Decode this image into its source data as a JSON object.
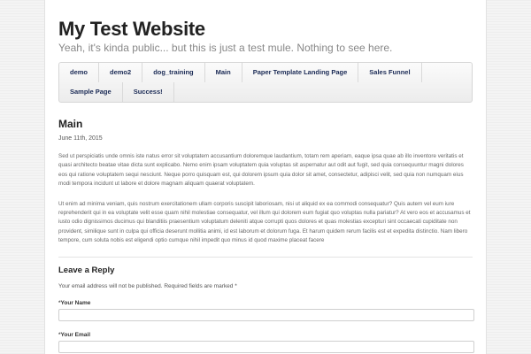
{
  "site": {
    "title": "My Test Website",
    "tagline": "Yeah, it's kinda public... but this is just a test mule. Nothing to see here."
  },
  "nav": {
    "row1": [
      "demo",
      "demo2",
      "dog_training",
      "Main",
      "Paper Template Landing Page",
      "Sales Funnel"
    ],
    "row2": [
      "Sample Page",
      "Success!"
    ]
  },
  "post": {
    "title": "Main",
    "date": "June 11th, 2015",
    "paragraph1": "Sed ut perspiciatis unde omnis iste natus error sit voluptatem accusantium doloremque laudantium, totam rem aperiam, eaque ipsa quae ab illo inventore veritatis et quasi architecto beatae vitae dicta sunt explicabo. Nemo enim ipsam voluptatem quia voluptas sit aspernatur aut odit aut fugit, sed quia consequuntur magni dolores eos qui ratione voluptatem sequi nesciunt. Neque porro quisquam est, qui dolorem ipsum quia dolor sit amet, consectetur, adipisci velit, sed quia non numquam eius modi tempora incidunt ut labore et dolore magnam aliquam quaerat voluptatem.",
    "paragraph2": "Ut enim ad minima veniam, quis nostrum exercitationem ullam corporis suscipit laboriosam, nisi ut aliquid ex ea commodi consequatur? Quis autem vel eum iure reprehenderit qui in ea voluptate velit esse quam nihil molestiae consequatur, vel illum qui dolorem eum fugiat quo voluptas nulla pariatur? At vero eos et accusamus et iusto odio dignissimos ducimus qui blanditiis praesentium voluptatum deleniti atque corrupti quos dolores et quas molestias excepturi sint occaecati cupiditate non provident, similique sunt in culpa qui officia deserunt mollitia animi, id est laborum et dolorum fuga. Et harum quidem rerum facilis est et expedita distinctio. Nam libero tempore, cum soluta nobis est eligendi optio cumque nihil impedit quo minus id quod maxime placeat facere"
  },
  "reply": {
    "title": "Leave a Reply",
    "notes": "Your email address will not be published. Required fields are marked *",
    "required_marker": "*",
    "name_label": "Your Name",
    "email_label": "Your Email"
  }
}
